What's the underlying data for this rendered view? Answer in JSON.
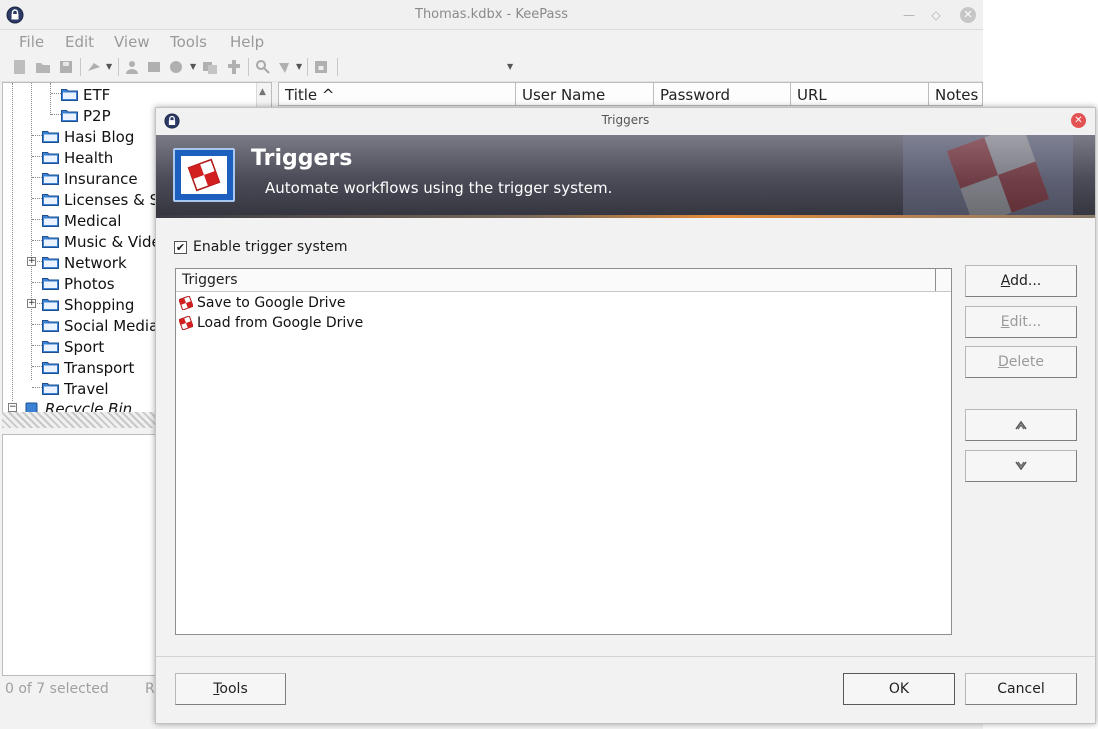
{
  "main_window": {
    "title": "Thomas.kdbx - KeePass",
    "menu": [
      "File",
      "Edit",
      "View",
      "Tools",
      "Help"
    ],
    "tree": [
      {
        "label": "ETF",
        "level": 2
      },
      {
        "label": "P2P",
        "level": 2
      },
      {
        "label": "Hasi Blog",
        "level": 1
      },
      {
        "label": "Health",
        "level": 1
      },
      {
        "label": "Insurance",
        "level": 1
      },
      {
        "label": "Licenses & S",
        "level": 1
      },
      {
        "label": "Medical",
        "level": 1
      },
      {
        "label": "Music & Vide",
        "level": 1
      },
      {
        "label": "Network",
        "level": 1,
        "expandable": true
      },
      {
        "label": "Photos",
        "level": 1
      },
      {
        "label": "Shopping",
        "level": 1,
        "expandable": true
      },
      {
        "label": "Social Media",
        "level": 1
      },
      {
        "label": "Sport",
        "level": 1
      },
      {
        "label": "Transport",
        "level": 1
      },
      {
        "label": "Travel",
        "level": 1
      },
      {
        "label": "Recycle Bin",
        "level": 0,
        "italic": true
      }
    ],
    "columns": [
      "Title ^",
      "User Name",
      "Password",
      "URL",
      "Notes"
    ],
    "status_selected": "0 of 7 selected",
    "status_right": "R"
  },
  "dialog": {
    "window_title": "Triggers",
    "banner_title": "Triggers",
    "banner_subtitle": "Automate workflows using the trigger system.",
    "enable_label": "Enable trigger system",
    "enable_checked": true,
    "list_header": "Triggers",
    "triggers": [
      {
        "name": "Save to Google Drive"
      },
      {
        "name": "Load from Google Drive"
      }
    ],
    "buttons": {
      "add_pre": "",
      "add_u": "A",
      "add_post": "dd...",
      "edit_pre": "",
      "edit_u": "E",
      "edit_post": "dit...",
      "delete_pre": "",
      "delete_u": "D",
      "delete_post": "elete",
      "up_icon": "chevron-up-icon",
      "down_icon": "chevron-down-icon",
      "tools_pre": "",
      "tools_u": "T",
      "tools_post": "ools",
      "ok": "OK",
      "cancel": "Cancel"
    }
  }
}
